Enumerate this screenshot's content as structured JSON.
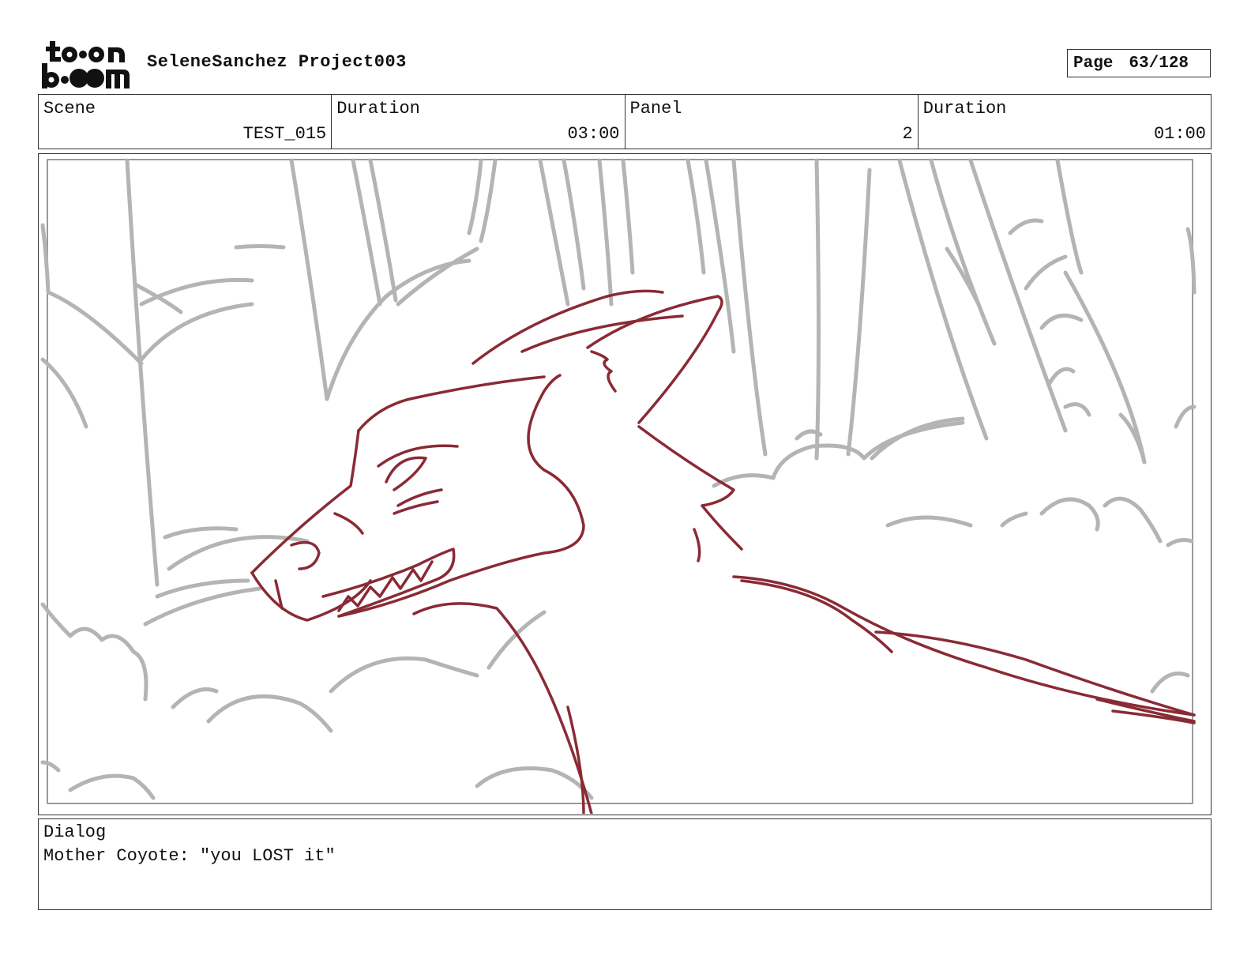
{
  "logo": {
    "alt": "toon boom",
    "icon": "toon-boom-logo"
  },
  "header": {
    "project_title": "SeleneSanchez Project003",
    "page_label": "Page",
    "page_value": "63/128"
  },
  "info": {
    "scene_label": "Scene",
    "scene_value": "TEST_015",
    "scene_duration_label": "Duration",
    "scene_duration_value": "03:00",
    "panel_label": "Panel",
    "panel_value": "2",
    "panel_duration_label": "Duration",
    "panel_duration_value": "01:00"
  },
  "panel": {
    "image_icon": "storyboard-sketch-coyote",
    "colors": {
      "character_line": "#8a2a35",
      "background_line": "#b4b4b4"
    }
  },
  "dialog": {
    "label": "Dialog",
    "text": "Mother Coyote: \"you LOST it\""
  }
}
